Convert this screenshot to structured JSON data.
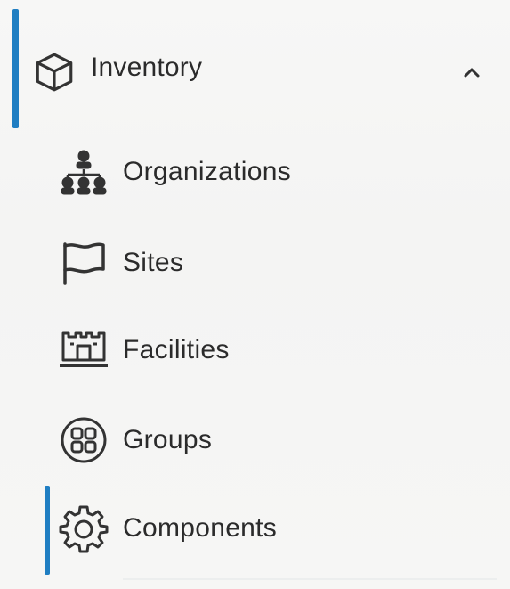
{
  "nav": {
    "section": {
      "label": "Inventory",
      "icon": "cube-icon",
      "toggle_icon": "chevron-up-icon",
      "expanded": true
    },
    "items": [
      {
        "label": "Organizations",
        "icon": "organizations-icon",
        "active": false
      },
      {
        "label": "Sites",
        "icon": "flag-icon",
        "active": false
      },
      {
        "label": "Facilities",
        "icon": "facility-icon",
        "active": false
      },
      {
        "label": "Groups",
        "icon": "groups-icon",
        "active": false
      },
      {
        "label": "Components",
        "icon": "gear-icon",
        "active": true
      }
    ],
    "colors": {
      "accent": "#1f7ec2",
      "text": "#2b2b2b",
      "icon": "#333333",
      "background": "#f6f6f5"
    }
  }
}
